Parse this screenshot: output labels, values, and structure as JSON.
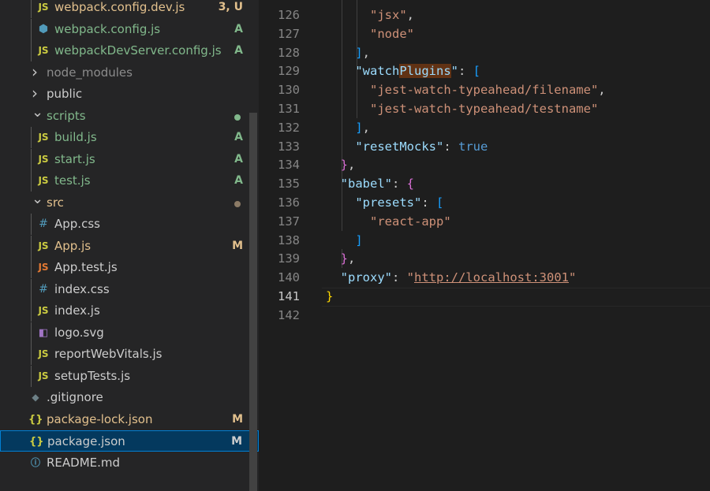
{
  "explorer": {
    "items": [
      {
        "type": "file",
        "icon": "js-icon",
        "glyph": "JS",
        "iconClass": "i-js",
        "label": "webpack.config.dev.js",
        "labelClass": "c-mod",
        "badge": "3, U",
        "badgeClass": "c-mod",
        "depth": 1
      },
      {
        "type": "file",
        "icon": "config-icon",
        "glyph": "⬢",
        "iconClass": "i-cfg",
        "label": "webpack.config.js",
        "labelClass": "c-add",
        "badge": "A",
        "badgeClass": "c-add",
        "depth": 1
      },
      {
        "type": "file",
        "icon": "js-icon",
        "glyph": "JS",
        "iconClass": "i-js",
        "label": "webpackDevServer.config.js",
        "labelClass": "c-add",
        "badge": "A",
        "badgeClass": "c-add",
        "depth": 1
      },
      {
        "type": "folder",
        "open": false,
        "label": "node_modules",
        "labelClass": "c-dim",
        "depth": 0
      },
      {
        "type": "folder",
        "open": false,
        "label": "public",
        "labelClass": "c-def",
        "depth": 0
      },
      {
        "type": "folder",
        "open": true,
        "label": "scripts",
        "labelClass": "c-add",
        "dot": "#81b88b",
        "depth": 0
      },
      {
        "type": "file",
        "icon": "js-icon",
        "glyph": "JS",
        "iconClass": "i-js",
        "label": "build.js",
        "labelClass": "c-add",
        "badge": "A",
        "badgeClass": "c-add",
        "depth": 1
      },
      {
        "type": "file",
        "icon": "js-icon",
        "glyph": "JS",
        "iconClass": "i-js",
        "label": "start.js",
        "labelClass": "c-add",
        "badge": "A",
        "badgeClass": "c-add",
        "depth": 1
      },
      {
        "type": "file",
        "icon": "js-icon",
        "glyph": "JS",
        "iconClass": "i-js",
        "label": "test.js",
        "labelClass": "c-add",
        "badge": "A",
        "badgeClass": "c-add",
        "depth": 1
      },
      {
        "type": "folder",
        "open": true,
        "label": "src",
        "labelClass": "c-mod",
        "dot": "#8c7b66",
        "depth": 0
      },
      {
        "type": "file",
        "icon": "css-icon",
        "glyph": "#",
        "iconClass": "i-css",
        "label": "App.css",
        "labelClass": "c-def",
        "depth": 1
      },
      {
        "type": "file",
        "icon": "js-icon",
        "glyph": "JS",
        "iconClass": "i-js",
        "label": "App.js",
        "labelClass": "c-mod",
        "badge": "M",
        "badgeClass": "c-mod",
        "depth": 1
      },
      {
        "type": "file",
        "icon": "test-js-icon",
        "glyph": "JS",
        "iconClass": "i-test",
        "label": "App.test.js",
        "labelClass": "c-def",
        "depth": 1
      },
      {
        "type": "file",
        "icon": "css-icon",
        "glyph": "#",
        "iconClass": "i-css",
        "label": "index.css",
        "labelClass": "c-def",
        "depth": 1
      },
      {
        "type": "file",
        "icon": "js-icon",
        "glyph": "JS",
        "iconClass": "i-js",
        "label": "index.js",
        "labelClass": "c-def",
        "depth": 1
      },
      {
        "type": "file",
        "icon": "svg-icon",
        "glyph": "◧",
        "iconClass": "i-svg",
        "label": "logo.svg",
        "labelClass": "c-def",
        "depth": 1
      },
      {
        "type": "file",
        "icon": "js-icon",
        "glyph": "JS",
        "iconClass": "i-js",
        "label": "reportWebVitals.js",
        "labelClass": "c-def",
        "depth": 1
      },
      {
        "type": "file",
        "icon": "js-icon",
        "glyph": "JS",
        "iconClass": "i-js",
        "label": "setupTests.js",
        "labelClass": "c-def",
        "depth": 1
      },
      {
        "type": "file",
        "icon": "git-icon",
        "glyph": "◆",
        "iconClass": "i-git",
        "label": ".gitignore",
        "labelClass": "c-def",
        "depth": 0
      },
      {
        "type": "file",
        "icon": "json-icon",
        "glyph": "{}",
        "iconClass": "i-json",
        "label": "package-lock.json",
        "labelClass": "c-mod",
        "badge": "M",
        "badgeClass": "c-mod",
        "depth": 0
      },
      {
        "type": "file",
        "icon": "json-icon",
        "glyph": "{}",
        "iconClass": "i-json",
        "label": "package.json",
        "labelClass": "c-def",
        "badge": "M",
        "badgeClass": "c-def",
        "depth": 0,
        "selected": true
      },
      {
        "type": "file",
        "icon": "info-icon",
        "glyph": "ⓘ",
        "iconClass": "i-info",
        "label": "README.md",
        "labelClass": "c-def",
        "depth": 0
      }
    ]
  },
  "editor": {
    "current_line": "141",
    "lines": [
      {
        "n": "126",
        "tokens": [
          [
            "      ",
            "tk-p"
          ],
          [
            "\"jsx\"",
            "tk-s"
          ],
          [
            ",",
            "tk-p"
          ]
        ]
      },
      {
        "n": "127",
        "tokens": [
          [
            "      ",
            "tk-p"
          ],
          [
            "\"node\"",
            "tk-s"
          ]
        ]
      },
      {
        "n": "128",
        "tokens": [
          [
            "    ",
            "tk-p"
          ],
          [
            "]",
            "tk-b3"
          ],
          [
            ",",
            "tk-p"
          ]
        ]
      },
      {
        "n": "129",
        "tokens": [
          [
            "    ",
            "tk-p"
          ],
          [
            "\"watch",
            "tk-k"
          ],
          [
            "Plugins",
            "tk-k tk-hl"
          ],
          [
            "\"",
            "tk-k"
          ],
          [
            ": ",
            "tk-p"
          ],
          [
            "[",
            "tk-b3"
          ]
        ]
      },
      {
        "n": "130",
        "tokens": [
          [
            "      ",
            "tk-p"
          ],
          [
            "\"jest-watch-typeahead/filename\"",
            "tk-s"
          ],
          [
            ",",
            "tk-p"
          ]
        ]
      },
      {
        "n": "131",
        "tokens": [
          [
            "      ",
            "tk-p"
          ],
          [
            "\"jest-watch-typeahead/testname\"",
            "tk-s"
          ]
        ]
      },
      {
        "n": "132",
        "tokens": [
          [
            "    ",
            "tk-p"
          ],
          [
            "]",
            "tk-b3"
          ],
          [
            ",",
            "tk-p"
          ]
        ]
      },
      {
        "n": "133",
        "tokens": [
          [
            "    ",
            "tk-p"
          ],
          [
            "\"resetMocks\"",
            "tk-k"
          ],
          [
            ": ",
            "tk-p"
          ],
          [
            "true",
            "tk-bool"
          ]
        ]
      },
      {
        "n": "134",
        "tokens": [
          [
            "  ",
            "tk-p"
          ],
          [
            "}",
            "tk-b2"
          ],
          [
            ",",
            "tk-p"
          ]
        ]
      },
      {
        "n": "135",
        "tokens": [
          [
            "  ",
            "tk-p"
          ],
          [
            "\"babel\"",
            "tk-k"
          ],
          [
            ": ",
            "tk-p"
          ],
          [
            "{",
            "tk-b2"
          ]
        ]
      },
      {
        "n": "136",
        "tokens": [
          [
            "    ",
            "tk-p"
          ],
          [
            "\"presets\"",
            "tk-k"
          ],
          [
            ": ",
            "tk-p"
          ],
          [
            "[",
            "tk-b3"
          ]
        ]
      },
      {
        "n": "137",
        "tokens": [
          [
            "      ",
            "tk-p"
          ],
          [
            "\"react-app\"",
            "tk-s"
          ]
        ]
      },
      {
        "n": "138",
        "tokens": [
          [
            "    ",
            "tk-p"
          ],
          [
            "]",
            "tk-b3"
          ]
        ]
      },
      {
        "n": "139",
        "tokens": [
          [
            "  ",
            "tk-p"
          ],
          [
            "}",
            "tk-b2"
          ],
          [
            ",",
            "tk-p"
          ]
        ]
      },
      {
        "n": "140",
        "tokens": [
          [
            "  ",
            "tk-p"
          ],
          [
            "\"proxy\"",
            "tk-k"
          ],
          [
            ": ",
            "tk-p"
          ],
          [
            "\"",
            "tk-s"
          ],
          [
            "http://localhost:3001",
            "tk-s tk-url"
          ],
          [
            "\"",
            "tk-s"
          ]
        ]
      },
      {
        "n": "141",
        "tokens": [
          [
            "}",
            "tk-b1"
          ]
        ]
      },
      {
        "n": "142",
        "tokens": []
      }
    ]
  }
}
